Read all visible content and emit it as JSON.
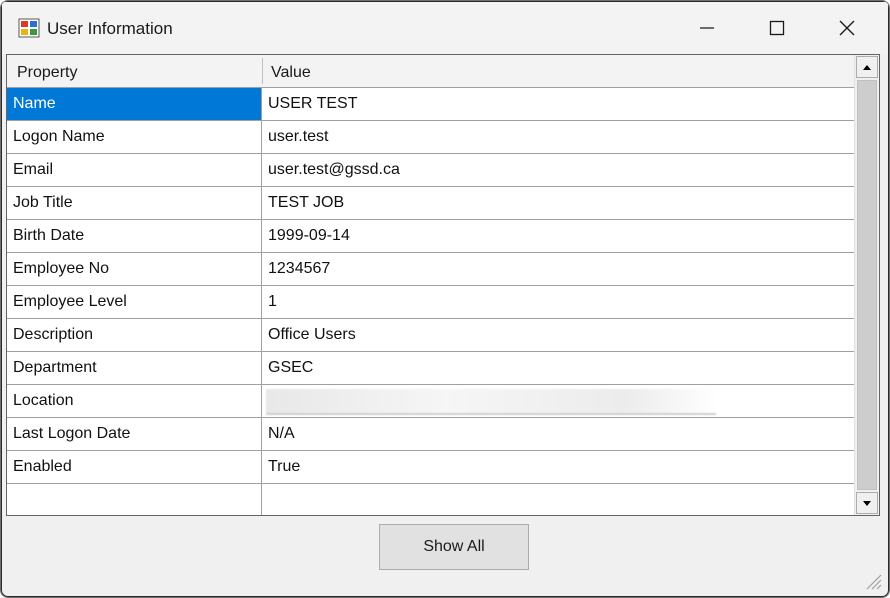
{
  "window": {
    "title": "User Information",
    "controls": {
      "minimize": "minimize-icon",
      "maximize": "maximize-icon",
      "close": "close-icon"
    }
  },
  "grid": {
    "columns": [
      "Property",
      "Value"
    ],
    "selected_color": "#0078d7",
    "rows": [
      {
        "property": "Name",
        "value": "USER TEST"
      },
      {
        "property": "Logon Name",
        "value": "user.test"
      },
      {
        "property": "Email",
        "value": "user.test@gssd.ca"
      },
      {
        "property": "Job Title",
        "value": "TEST JOB"
      },
      {
        "property": "Birth Date",
        "value": "1999-09-14"
      },
      {
        "property": "Employee No",
        "value": "1234567"
      },
      {
        "property": "Employee Level",
        "value": "1"
      },
      {
        "property": "Description",
        "value": "Office Users"
      },
      {
        "property": "Department",
        "value": "GSEC"
      },
      {
        "property": "Location",
        "value": ""
      },
      {
        "property": "Last Logon Date",
        "value": "N/A"
      },
      {
        "property": "Enabled",
        "value": "True"
      }
    ]
  },
  "buttons": {
    "show_all": "Show All"
  }
}
